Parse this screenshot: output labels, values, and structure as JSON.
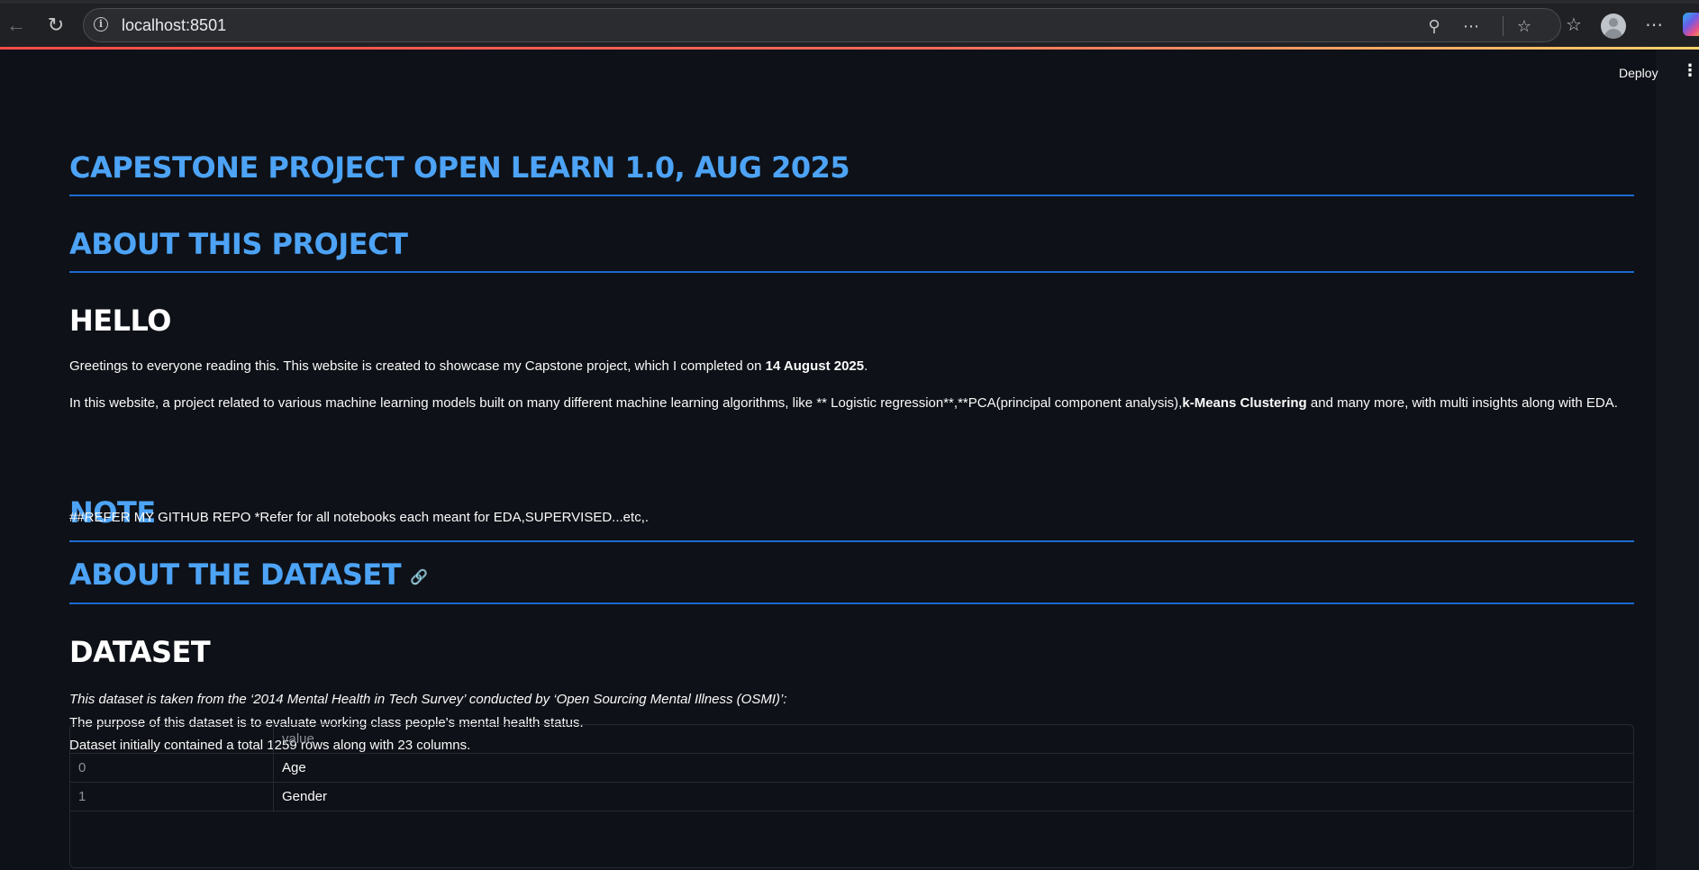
{
  "browser": {
    "url": "localhost:8501"
  },
  "header": {
    "deploy_label": "Deploy",
    "menu_label": "⋮"
  },
  "content": {
    "title": "CAPESTONE PROJECT OPEN LEARN 1.0, AUG 2025",
    "about_project": "ABOUT THIS PROJECT",
    "hello": "HELLO",
    "greeting_text": "Greetings to everyone reading this. This website is created to showcase my Capstone project, which I completed on ",
    "greeting_date": "14 August 2025",
    "greeting_end": ".",
    "project_text_1": "In this website, a project related to various machine learning models built on many different machine learning algorithms, like ** Logistic regression**,**PCA(principal component analysis),",
    "project_bold": "k-Means Clustering",
    "project_text_2": " and many more, with multi insights along with EDA.",
    "note_heading": "NOTE",
    "note_text": "##REFER MY GITHUB REPO *Refer for all notebooks each meant for EDA,SUPERVISED...etc,.",
    "about_dataset": "ABOUT THE DATASET",
    "dataset_heading": "DATASET",
    "dataset_italic": "This dataset is taken from the ‘2014 Mental Health in Tech Survey’ conducted by ‘Open Sourcing Mental Illness (OSMI)’:",
    "dataset_purpose": "The purpose of this dataset is to evaluate working class people's mental health status.",
    "dataset_size": "Dataset initially contained a total 1259 rows along with 23 columns."
  },
  "table": {
    "header": [
      "",
      "value"
    ],
    "rows": [
      {
        "index": "0",
        "value": "Age"
      },
      {
        "index": "1",
        "value": "Gender"
      }
    ]
  }
}
